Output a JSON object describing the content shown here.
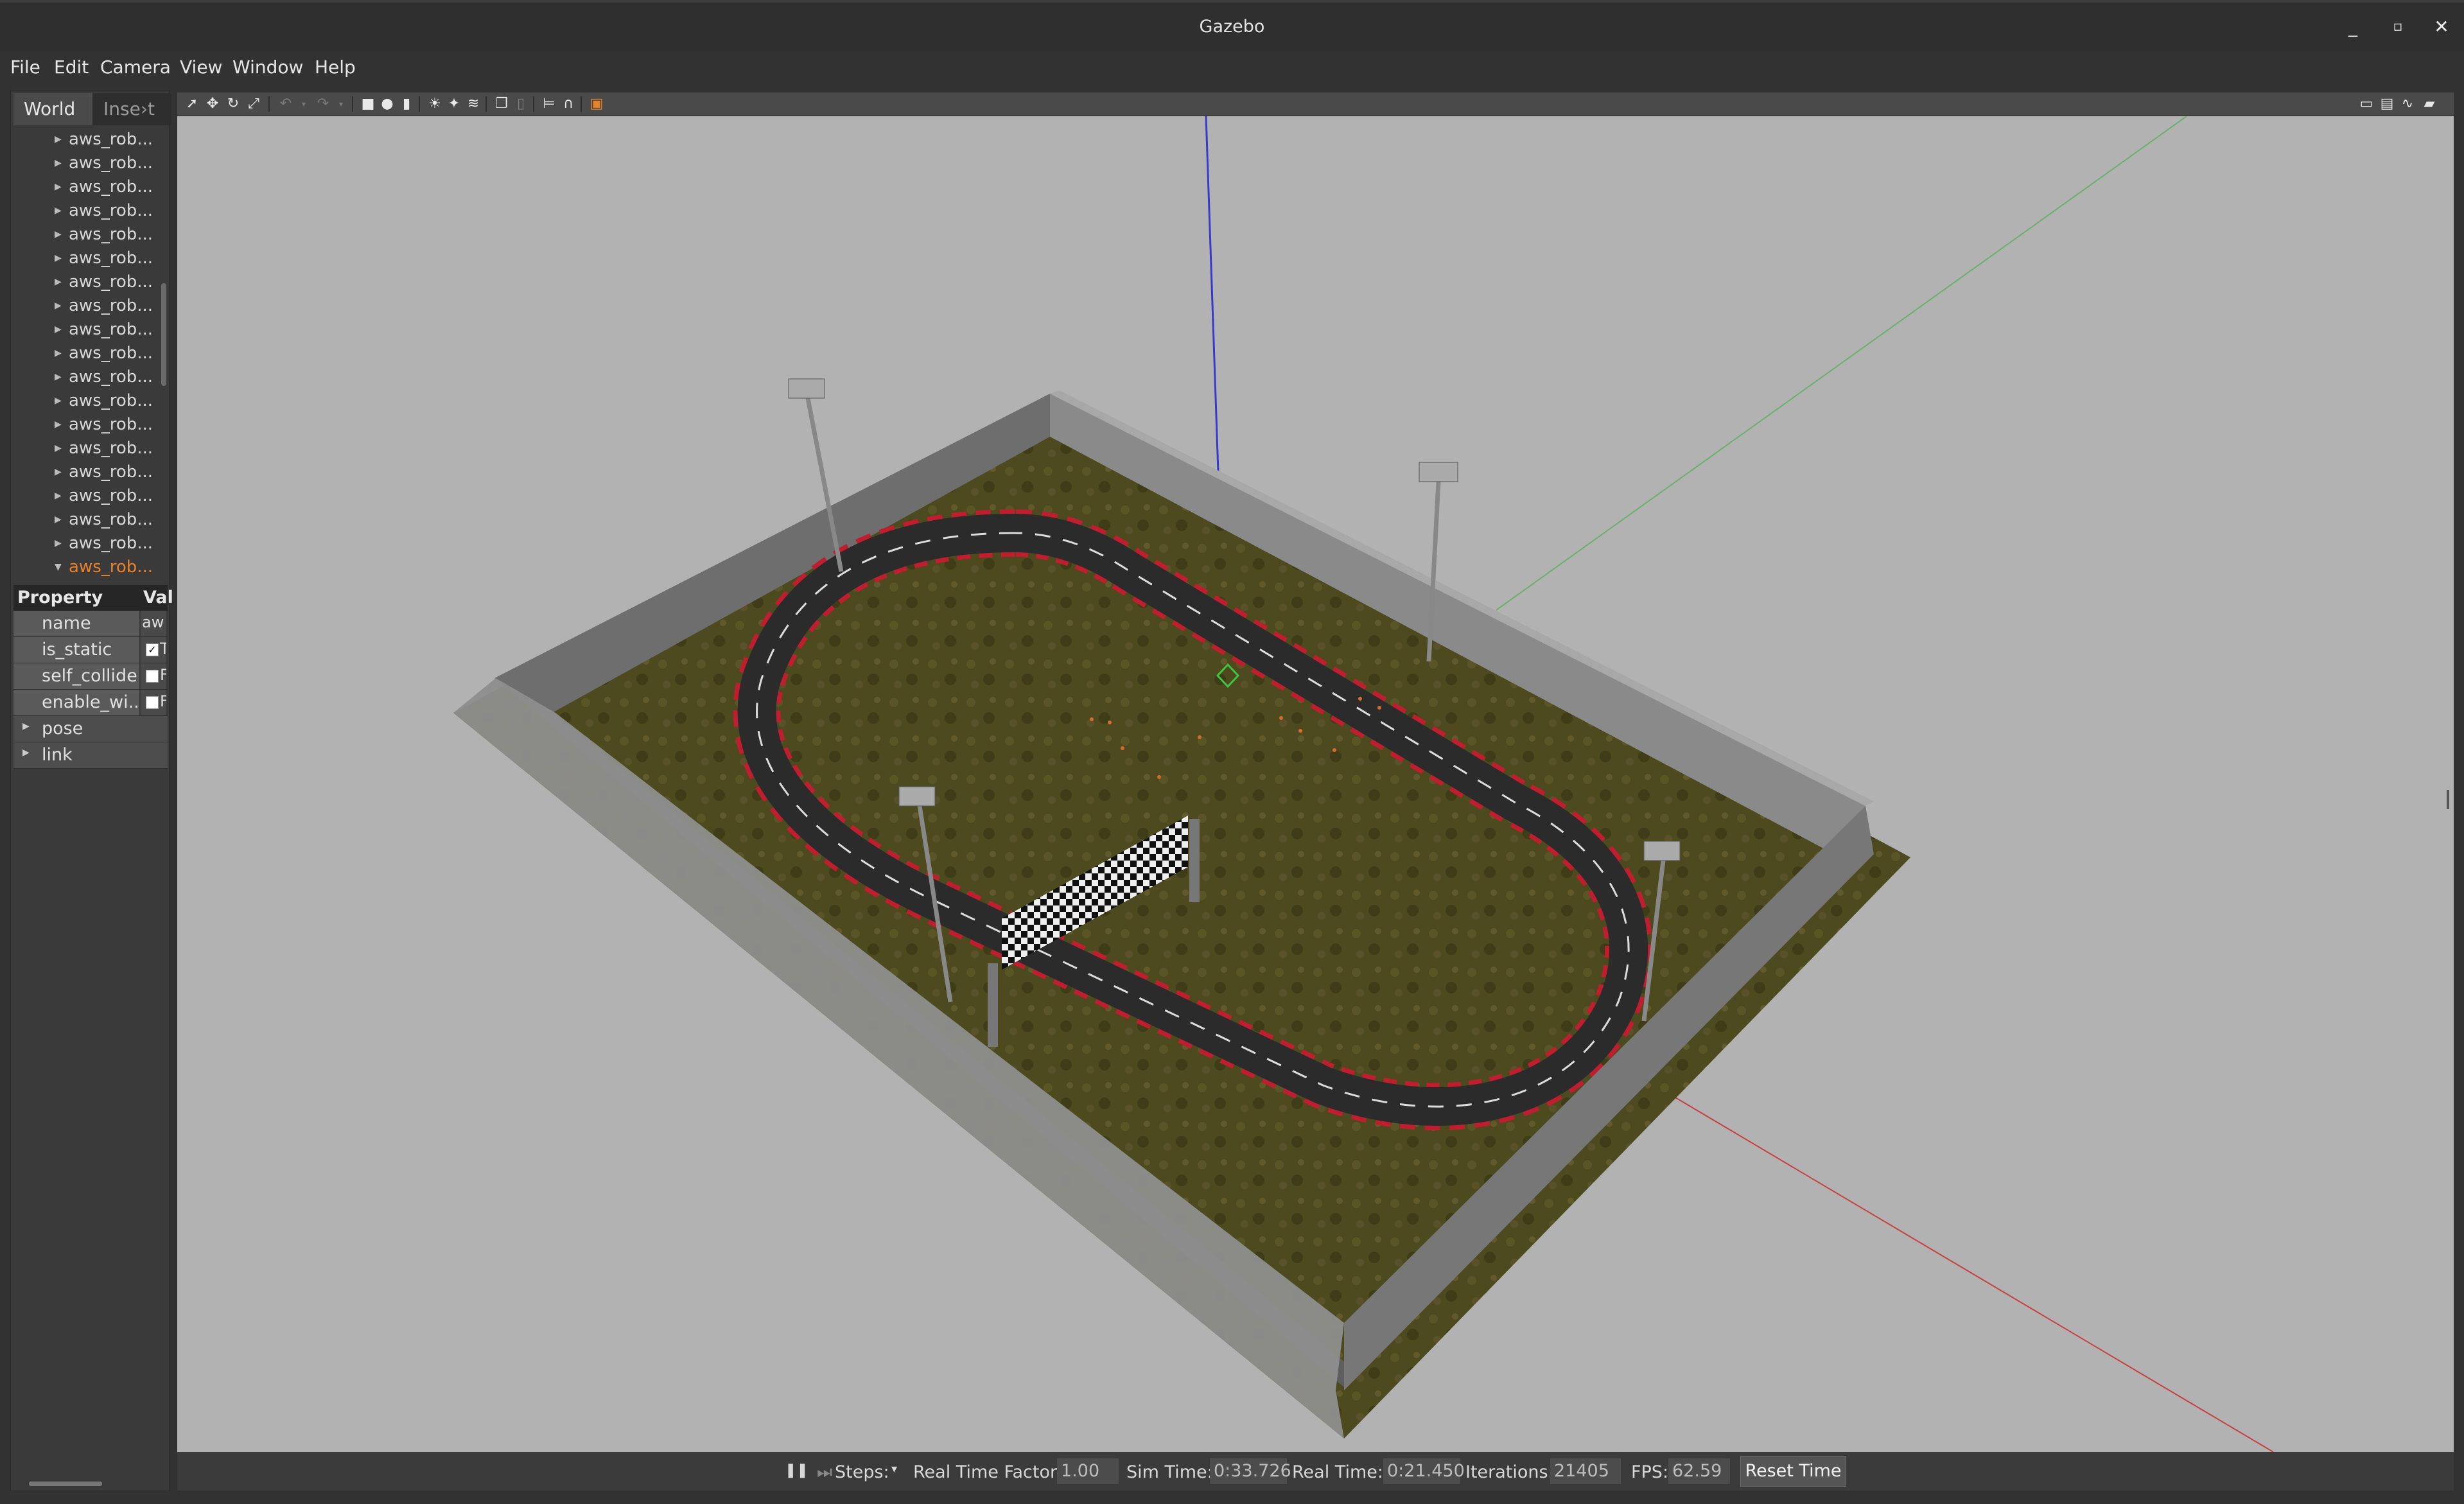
{
  "window": {
    "title": "Gazebo",
    "minimize": "_",
    "maximize": "▫",
    "close": "✕"
  },
  "menu": [
    "File",
    "Edit",
    "Camera",
    "View",
    "Window",
    "Help"
  ],
  "left_panel": {
    "tabs": [
      "World",
      "Inse›t"
    ],
    "tree_items": [
      "aws_rob...",
      "aws_rob...",
      "aws_rob...",
      "aws_rob...",
      "aws_rob...",
      "aws_rob...",
      "aws_rob...",
      "aws_rob...",
      "aws_rob...",
      "aws_rob...",
      "aws_rob...",
      "aws_rob...",
      "aws_rob...",
      "aws_rob...",
      "aws_rob...",
      "aws_rob...",
      "aws_rob...",
      "aws_rob...",
      "aws_rob..."
    ],
    "selected_item_index": 18,
    "property_header": {
      "property": "Property",
      "value": "Val"
    },
    "properties": [
      {
        "key": "name",
        "value": "aw"
      },
      {
        "key": "is_static",
        "checked": true,
        "value": "T"
      },
      {
        "key": "self_collide",
        "checked": false,
        "value": "F"
      },
      {
        "key": "enable_wi...",
        "checked": false,
        "value": "F"
      }
    ],
    "groups": [
      "pose",
      "link"
    ]
  },
  "toolbar": {
    "icons": [
      "select-icon",
      "translate-icon",
      "rotate-icon",
      "scale-icon",
      "undo-icon",
      "redo-icon",
      "box-icon",
      "sphere-icon",
      "cylinder-icon",
      "point-light-icon",
      "spot-light-icon",
      "directional-light-icon",
      "copy-icon",
      "paste-icon",
      "align-icon",
      "snap-icon",
      "color-icon",
      "screenshot-icon",
      "log-icon",
      "plot-icon",
      "video-icon"
    ]
  },
  "status": {
    "pause": "❚❚",
    "steps_label": "Steps: ",
    "real_time_factor_label": "Real Time Factor:",
    "real_time_factor": "1.00",
    "sim_time_label": "Sim Time:",
    "sim_time": "0:33.726",
    "real_time_label": "Real Time:",
    "real_time": "0:21.450",
    "iterations_label": "Iterations:",
    "iterations": "21405",
    "fps_label": "FPS:",
    "fps": "62.59",
    "reset_label": "Reset Time"
  },
  "colors": {
    "selection": "#e8822a",
    "viewport_bg": "#b2b2b2",
    "grass": "#4f4d1f",
    "wall": "#8c8c8c"
  }
}
